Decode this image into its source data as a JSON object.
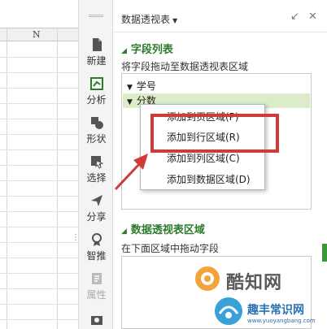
{
  "sheet": {
    "column_label": "N"
  },
  "toolbar": {
    "items": [
      {
        "label": "新建",
        "icon": "new-file-icon"
      },
      {
        "label": "分析",
        "icon": "analysis-icon"
      },
      {
        "label": "形状",
        "icon": "shape-icon"
      },
      {
        "label": "选择",
        "icon": "select-icon"
      },
      {
        "label": "分享",
        "icon": "share-icon"
      },
      {
        "label": "智推",
        "icon": "smart-push-icon"
      },
      {
        "label": "属性",
        "icon": "properties-icon"
      }
    ]
  },
  "panel": {
    "title": "数据透视表",
    "field_section": {
      "title": "字段列表",
      "hint": "将字段拖动至数据透视表区域"
    },
    "fields": [
      {
        "label": "学号"
      },
      {
        "label": "分数"
      }
    ],
    "area_section": {
      "title": "数据透视表区域",
      "hint": "在下面区域中拖动字段"
    }
  },
  "context_menu": {
    "items": [
      "添加到页区域(P)",
      "添加到行区域(R)",
      "添加到列区域(C)",
      "添加到数据区域(D)"
    ]
  },
  "watermark": {
    "brand": "酷知网",
    "site_name": "趣丰常识网",
    "site_url": "www.yuoyangbang.com"
  },
  "colors": {
    "accent_green": "#2d7a2d",
    "highlight_red": "#d23a3a",
    "selected_row": "#dcecc9"
  }
}
